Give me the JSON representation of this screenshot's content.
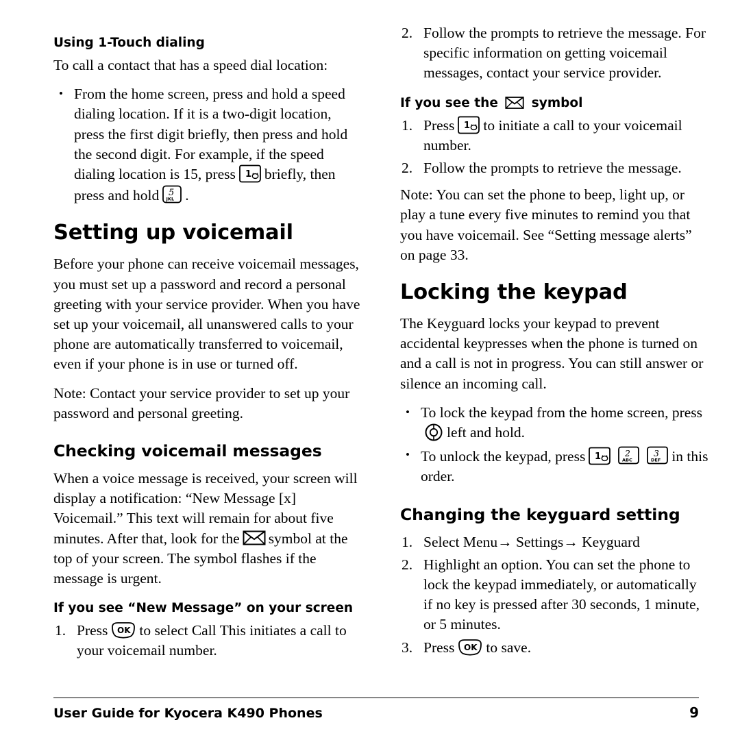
{
  "document": {
    "footer": {
      "guide_text": "User Guide for Kyocera K490 Phones",
      "page_number": "9"
    }
  },
  "left_column": {
    "heading_1touch": "Using 1-Touch dialing",
    "intro_1touch": "To call a contact that has a speed dial location:",
    "bullet_1touch_a": "From the home screen, press and hold a speed dialing location. If it is a two-digit location, press the first digit briefly, then press and hold the second digit. For example, if the speed dialing location is 15, press",
    "bullet_1touch_b": "briefly, then press and hold",
    "bullet_1touch_c": ".",
    "chapter_voicemail": "Setting up voicemail",
    "voicemail_para_1": "Before your phone can receive voicemail messages, you must set up a password and record a personal greeting with your service provider. When you have set up your voicemail, all unanswered calls to your phone are automatically transferred to voicemail, even if your phone is in use or turned off.",
    "voicemail_note": "Note: Contact your service provider to set up your password and personal greeting.",
    "heading_checking": "Checking voicemail messages",
    "checking_para_a": "When a voice message is received, your screen will display a notification: “New Message [x] Voicemail.” This text will remain for about five minutes. After that, look for the",
    "checking_para_b": "symbol at the top of your screen. The symbol flashes if the message is urgent.",
    "heading_newmessage": "If you see “New Message” on your screen",
    "newmessage_step_1a": "Press",
    "newmessage_step_1b": "to select Call This initiates a call to your voicemail number."
  },
  "right_column": {
    "step_2_top": "Follow the prompts to retrieve the message. For specific information on getting voicemail messages, contact your service provider.",
    "heading_symbol_a": "If you see the",
    "heading_symbol_b": "symbol",
    "symbol_step_1a": "Press",
    "symbol_step_1b": "to initiate a call to your voicemail number.",
    "symbol_step_2": "Follow the prompts to retrieve the message.",
    "voicemail_note_2": "Note: You can set the phone to beep, light up, or play a tune every five minutes to remind you that you have voicemail. See “Setting message alerts” on page 33.",
    "chapter_locking": "Locking the keypad",
    "locking_para": "The Keyguard locks your keypad to prevent accidental keypresses when the phone is turned on and a call is not in progress. You can still answer or silence an incoming call.",
    "lock_bullet_1a": "To lock the keypad from the home screen, press",
    "lock_bullet_1b": "left and hold.",
    "lock_bullet_2a": "To unlock the keypad, press",
    "lock_bullet_2b": "in this order.",
    "heading_changing": "Changing the keyguard setting",
    "changing_step_1": "Select Menu→ Settings→ Keyguard",
    "changing_step_2": "Highlight an option. You can set the phone to lock the keypad immediately, or automatically if no key is pressed after 30 seconds, 1 minute, or 5 minutes.",
    "changing_step_3a": "Press",
    "changing_step_3b": "to save."
  },
  "icons": {
    "key_1_label": "1",
    "key_2_label": "2",
    "key_2_sub": "ABC",
    "key_3_label": "3",
    "key_3_sub": "DEF",
    "key_5_label": "5",
    "key_5_sub": "JKL",
    "ok_key_label": "OK",
    "envelope_name": "envelope-icon",
    "nav_key_name": "navigation-key-icon"
  }
}
